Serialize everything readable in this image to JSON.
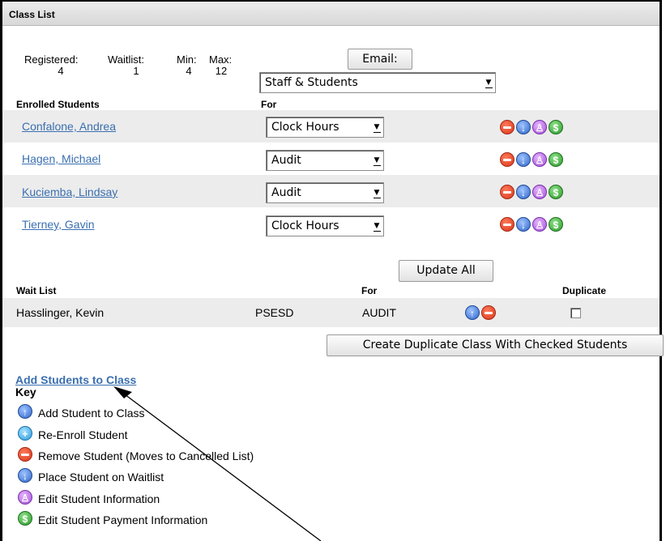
{
  "panel": {
    "title": "Class List"
  },
  "stats": {
    "labels": [
      "Registered:",
      "Waitlist:",
      "Min:",
      "Max:"
    ],
    "values": [
      "4",
      "1",
      "4",
      "12"
    ]
  },
  "email": {
    "button_label": "Email:",
    "recipients_selected": "Staff & Students"
  },
  "enrolled": {
    "header_students": "Enrolled Students",
    "header_for": "For",
    "rows": [
      {
        "name": "Confalone, Andrea",
        "for": "Clock Hours"
      },
      {
        "name": "Hagen, Michael",
        "for": "Audit"
      },
      {
        "name": "Kuciemba, Lindsay",
        "for": "Audit"
      },
      {
        "name": "Tierney, Gavin",
        "for": "Clock Hours"
      }
    ],
    "row_icons": [
      "remove-icon",
      "waitlist-icon",
      "edit-student-icon",
      "payment-icon"
    ],
    "update_all_label": "Update All"
  },
  "waitlist": {
    "header_list": "Wait List",
    "header_for": "For",
    "header_duplicate": "Duplicate",
    "rows": [
      {
        "name": "Hasslinger, Kevin",
        "district": "PSESD",
        "for": "AUDIT",
        "duplicate": false
      }
    ],
    "duplicate_button_label": "Create Duplicate Class With Checked Students"
  },
  "add_students_link": "Add Students to Class",
  "key": {
    "title": "Key",
    "items": [
      {
        "icon": "add-student-icon",
        "label": "Add Student to Class"
      },
      {
        "icon": "re-enroll-icon",
        "label": "Re-Enroll Student"
      },
      {
        "icon": "remove-icon",
        "label": "Remove Student (Moves to Cancelled List)"
      },
      {
        "icon": "waitlist-icon",
        "label": "Place Student on Waitlist"
      },
      {
        "icon": "edit-student-icon",
        "label": "Edit Student Information"
      },
      {
        "icon": "payment-icon",
        "label": "Edit Student Payment Information"
      }
    ]
  },
  "colors": {
    "link": "#3a6fb0",
    "row_shade": "#ececec",
    "remove": "#d9361b",
    "waitlist": "#2f66c8",
    "edit": "#a34fd8",
    "payment": "#2c9a2a"
  }
}
